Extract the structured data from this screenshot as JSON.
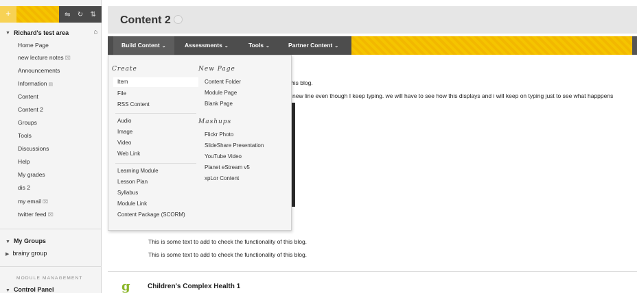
{
  "sidebar": {
    "toolbar": {
      "add_icon": "plus-icon",
      "tools": [
        "reorder-icon",
        "refresh-icon",
        "sort-icon"
      ]
    },
    "course_title": "Richard's test area",
    "items": [
      {
        "label": "Home Page",
        "mark": ""
      },
      {
        "label": "new lecture notes",
        "mark": "⌧"
      },
      {
        "label": "Announcements",
        "mark": ""
      },
      {
        "label": "Information",
        "mark": "▤"
      },
      {
        "label": "Content",
        "mark": ""
      },
      {
        "label": "Content 2",
        "mark": ""
      },
      {
        "label": "Groups",
        "mark": ""
      },
      {
        "label": "Tools",
        "mark": ""
      },
      {
        "label": "Discussions",
        "mark": ""
      },
      {
        "label": "Help",
        "mark": ""
      },
      {
        "label": "My grades",
        "mark": ""
      },
      {
        "label": "dis 2",
        "mark": ""
      },
      {
        "label": "my email",
        "mark": "⌧"
      },
      {
        "label": "twitter feed",
        "mark": "⌧"
      }
    ],
    "my_groups_label": "My Groups",
    "group_item": "brainy group",
    "module_heading": "MODULE MANAGEMENT",
    "control_panel_label": "Control Panel"
  },
  "page": {
    "title": "Content 2"
  },
  "action_bar": {
    "buttons": [
      "Build Content",
      "Assessments",
      "Tools",
      "Partner Content"
    ]
  },
  "build_menu": {
    "create_heading": "Create",
    "create_groups": [
      [
        "Item",
        "File",
        "RSS Content"
      ],
      [
        "Audio",
        "Image",
        "Video",
        "Web Link"
      ],
      [
        "Learning Module",
        "Lesson Plan",
        "Syllabus",
        "Module Link",
        "Content Package (SCORM)"
      ]
    ],
    "new_page_heading": "New Page",
    "new_page_items": [
      "Content Folder",
      "Module Page",
      "Blank Page"
    ],
    "mashups_heading": "Mashups",
    "mashups_items": [
      "Flickr Photo",
      "SlideShare Presentation",
      "YouTube Video",
      "Planet eStream v5",
      "xpLor Content"
    ]
  },
  "content": {
    "line1_visible": "his blog.",
    "line2_visible": "new line even though I keep typing. we will have to see how this displays and i will keep on typing just to see what happpens",
    "line3": "This is some text to add to check the functionality of this blog.",
    "line4": "This is some text to add to check the functionality of this blog.",
    "item_title": "Children's Complex Health 1"
  },
  "colors": {
    "accent_yellow": "#f5c400",
    "action_bar_dark": "#4d4d4d",
    "item_icon": "#8bb629"
  }
}
